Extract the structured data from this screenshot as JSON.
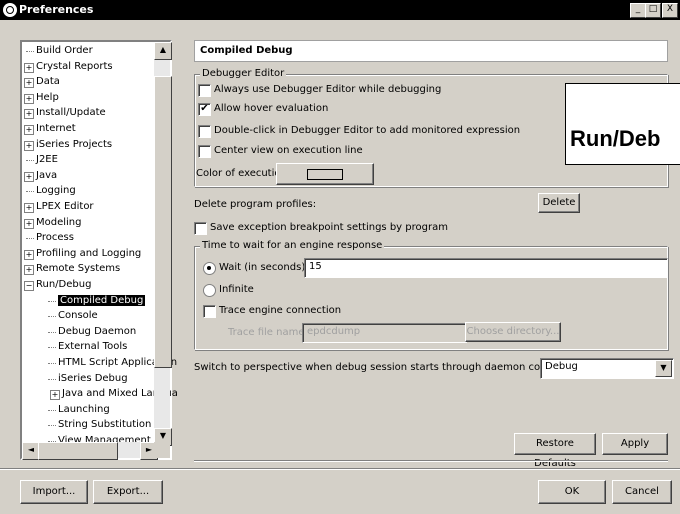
{
  "window": {
    "title": "Preferences",
    "minimize": "_",
    "maximize": "□",
    "close": "X"
  },
  "tree": {
    "items": [
      {
        "label": "Build Order",
        "exp": false
      },
      {
        "label": "Crystal Reports",
        "exp": true
      },
      {
        "label": "Data",
        "exp": true
      },
      {
        "label": "Help",
        "exp": true
      },
      {
        "label": "Install/Update",
        "exp": true
      },
      {
        "label": "Internet",
        "exp": true
      },
      {
        "label": "iSeries Projects",
        "exp": true
      },
      {
        "label": "J2EE",
        "exp": false
      },
      {
        "label": "Java",
        "exp": true
      },
      {
        "label": "Logging",
        "exp": false
      },
      {
        "label": "LPEX Editor",
        "exp": true
      },
      {
        "label": "Modeling",
        "exp": true
      },
      {
        "label": "Process",
        "exp": false
      },
      {
        "label": "Profiling and Logging",
        "exp": true
      },
      {
        "label": "Remote Systems",
        "exp": true
      },
      {
        "label": "Run/Debug",
        "exp": "open"
      }
    ],
    "children": [
      {
        "label": "Compiled Debug",
        "selected": true
      },
      {
        "label": "Console"
      },
      {
        "label": "Debug Daemon"
      },
      {
        "label": "External Tools"
      },
      {
        "label": "HTML Script Application"
      },
      {
        "label": "iSeries Debug"
      },
      {
        "label": "Java and Mixed Langua",
        "exp": true
      },
      {
        "label": "Launching"
      },
      {
        "label": "String Substitution"
      },
      {
        "label": "View Management"
      }
    ],
    "expand_symbol": "+",
    "collapse_symbol": "−"
  },
  "page": {
    "title": "Compiled Debug",
    "debugger_editor": {
      "legend": "Debugger Editor",
      "always_use": "Always use Debugger Editor while debugging",
      "allow_hover": "Allow hover evaluation",
      "double_click": "Double-click in Debugger Editor to add monitored expression",
      "center_view": "Center view on execution line",
      "color_label": "Color of execution line:"
    },
    "delete_profiles": {
      "label": "Delete program profiles:",
      "button": "Delete"
    },
    "save_exception": "Save exception breakpoint settings by program",
    "engine": {
      "legend": "Time to wait for an engine response",
      "wait_label": "Wait (in seconds):",
      "wait_value": "15",
      "infinite": "Infinite",
      "trace": "Trace engine connection",
      "trace_file_label": "Trace file name:",
      "trace_file_value": "epdcdump",
      "choose_dir": "Choose directory..."
    },
    "switch_label": "Switch to perspective when debug session starts through daemon connection:",
    "switch_value": "Debug",
    "restore_defaults": "Restore Defaults",
    "apply": "Apply"
  },
  "bottom": {
    "import": "Import...",
    "export": "Export...",
    "ok": "OK",
    "cancel": "Cancel"
  },
  "overlay": {
    "text": "Run/Deb"
  },
  "icons": {
    "check": "✔",
    "arrow_up": "▲",
    "arrow_down": "▼",
    "arrow_left": "◄",
    "arrow_right": "►",
    "dropdown": "▼"
  }
}
